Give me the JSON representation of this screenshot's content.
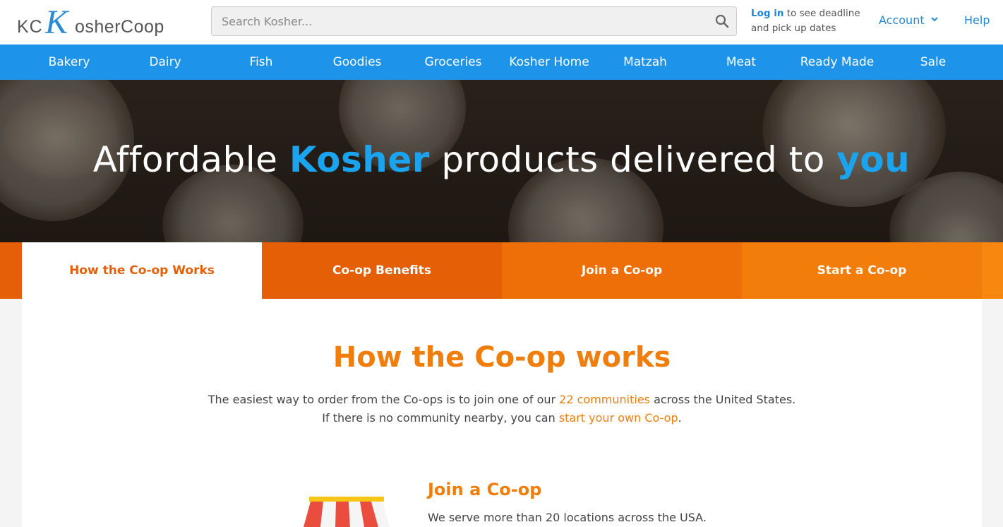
{
  "logo": {
    "kc": "KC",
    "k": "K",
    "rest": "osherCoop"
  },
  "search": {
    "placeholder": "Search Kosher..."
  },
  "login_note": {
    "link": "Log in",
    "text1": " to see deadline",
    "text2": "and pick up dates"
  },
  "account": {
    "label": "Account"
  },
  "help": {
    "label": "Help"
  },
  "nav": [
    "Bakery",
    "Dairy",
    "Fish",
    "Goodies",
    "Groceries",
    "Kosher Home",
    "Matzah",
    "Meat",
    "Ready Made",
    "Sale"
  ],
  "hero": {
    "part1": "Affordable ",
    "highlight1": "Kosher",
    "part2": " products delivered to ",
    "highlight2": "you"
  },
  "tabs": [
    "How the Co-op Works",
    "Co-op Benefits",
    "Join a Co-op",
    "Start a Co-op"
  ],
  "content": {
    "title": "How the Co-op works",
    "intro_1a": "The easiest way to order from the Co-ops is to join one of our ",
    "intro_1_link": "22 communities",
    "intro_1b": " across the United States.",
    "intro_2a": "If there is no community nearby, you can ",
    "intro_2_link": "start your own Co-op",
    "intro_2b": "."
  },
  "feature": {
    "title": "Join a Co-op",
    "text": "We serve more than 20 locations across the USA."
  },
  "colors": {
    "nav_blue": "#1e93ea",
    "accent_orange": "#ef7e0c",
    "tab_orange": "#e55f07",
    "link_blue": "#1e88d6"
  }
}
